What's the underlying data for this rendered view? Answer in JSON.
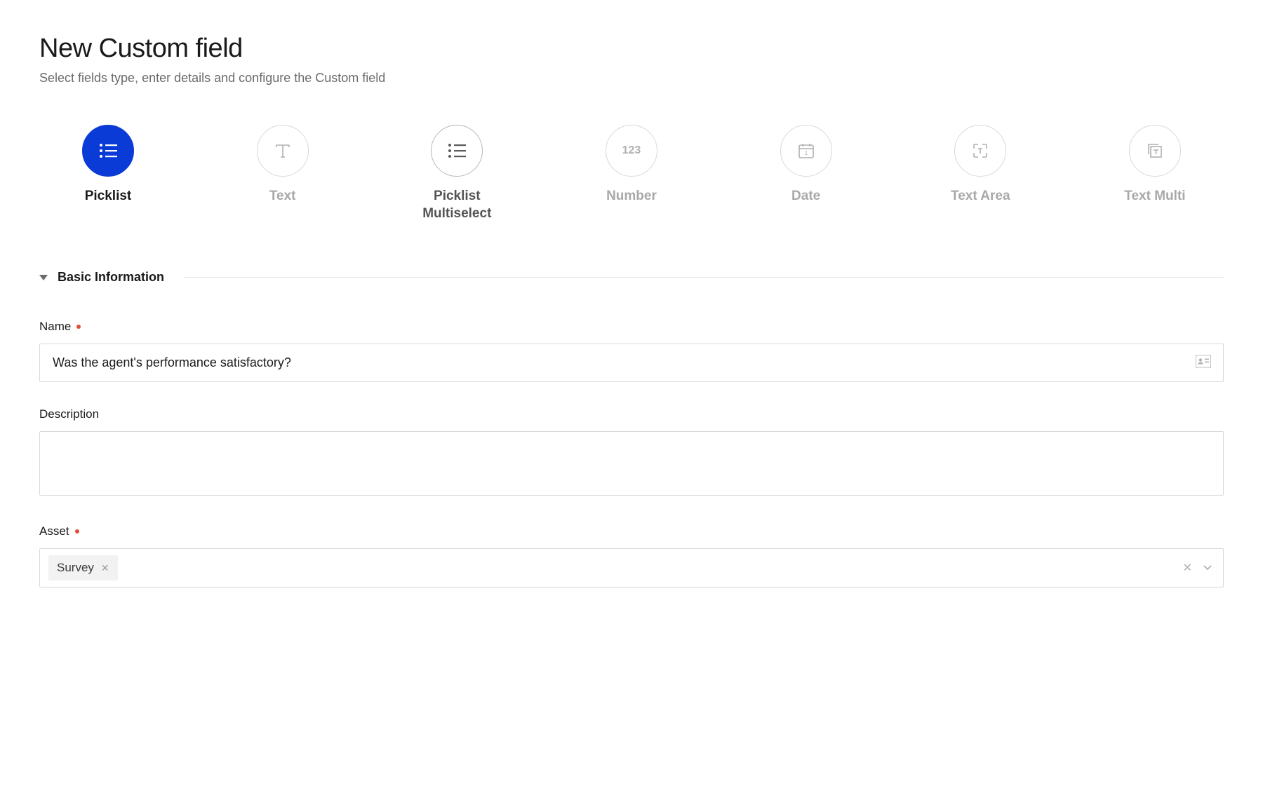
{
  "header": {
    "title": "New Custom field",
    "subtitle": "Select fields type, enter details and configure the Custom field"
  },
  "field_types": [
    {
      "id": "picklist",
      "label": "Picklist",
      "state": "selected",
      "icon": "picklist"
    },
    {
      "id": "text",
      "label": "Text",
      "state": "",
      "icon": "text"
    },
    {
      "id": "picklist_multi",
      "label": "Picklist Multiselect",
      "state": "sub-selected",
      "icon": "picklist"
    },
    {
      "id": "number",
      "label": "Number",
      "state": "",
      "icon": "number"
    },
    {
      "id": "date",
      "label": "Date",
      "state": "",
      "icon": "date"
    },
    {
      "id": "text_area",
      "label": "Text Area",
      "state": "",
      "icon": "textarea"
    },
    {
      "id": "text_multi",
      "label": "Text Multi",
      "state": "",
      "icon": "textmulti"
    }
  ],
  "section": {
    "title": "Basic Information"
  },
  "form": {
    "name_label": "Name",
    "name_value": "Was the agent's performance satisfactory?",
    "description_label": "Description",
    "description_value": "",
    "asset_label": "Asset",
    "asset_chip": "Survey"
  }
}
